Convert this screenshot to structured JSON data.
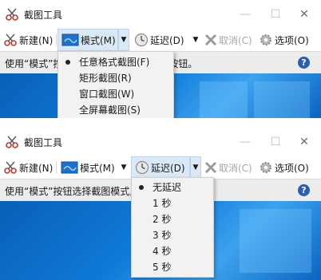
{
  "window": {
    "title": "截图工具",
    "controls": {
      "minimize": "—",
      "maximize": "☐",
      "close": "✕"
    }
  },
  "toolbar": {
    "new_label": "新建(N)",
    "mode_label": "模式(M)",
    "delay_label": "延迟(D)",
    "cancel_label": "取消(C)",
    "options_label": "选项(O)",
    "dropdown_arrow": "▼"
  },
  "screenshot_a": {
    "status_prefix": "使用“模式”按",
    "status_suffix": "”按钮。",
    "mode_menu": [
      {
        "label": "任意格式截图(F)",
        "selected": true
      },
      {
        "label": "矩形截图(R)",
        "selected": false
      },
      {
        "label": "窗口截图(W)",
        "selected": false
      },
      {
        "label": "全屏幕截图(S)",
        "selected": false
      }
    ]
  },
  "screenshot_b": {
    "status_text": "使用“模式”按钮选择截图模式,",
    "delay_menu": [
      {
        "label": "无延迟",
        "selected": true
      },
      {
        "label": "1 秒",
        "selected": false
      },
      {
        "label": "2 秒",
        "selected": false
      },
      {
        "label": "3 秒",
        "selected": false
      },
      {
        "label": "4 秒",
        "selected": false
      },
      {
        "label": "5 秒",
        "selected": false
      }
    ]
  },
  "help_label": "?",
  "icons": {
    "app": "scissors-icon",
    "new": "scissors-icon",
    "mode": "screenshot-mode-icon",
    "delay": "clock-icon",
    "cancel": "x-icon",
    "options": "gear-icon",
    "help": "help-icon"
  },
  "colors": {
    "highlight": "#dbe9f7",
    "menu_bg": "#f2f2f2",
    "status_bg": "#ececec",
    "desktop": "#0f7ad8",
    "help": "#2a5db8"
  }
}
